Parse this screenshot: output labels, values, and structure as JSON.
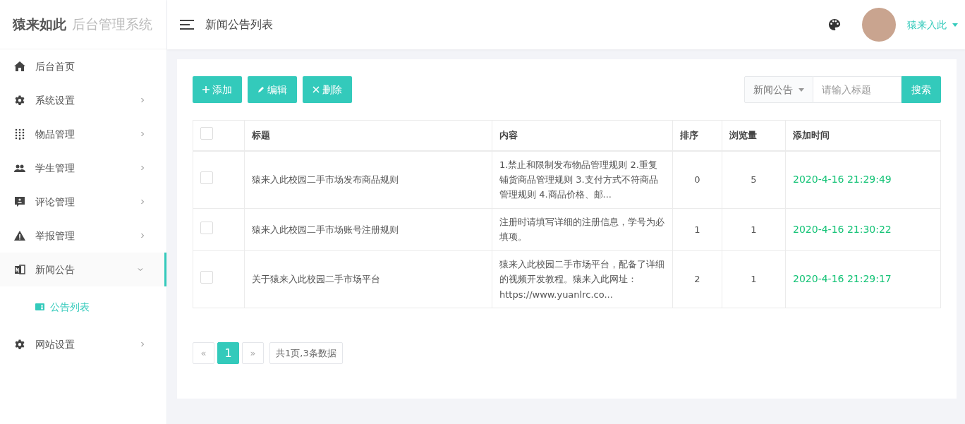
{
  "brand": {
    "logo": "猿来如此",
    "subtitle": "后台管理系统"
  },
  "header": {
    "title": "新闻公告列表",
    "user": "猿来入此"
  },
  "sidebar": {
    "items": [
      {
        "label": "后台首页",
        "selected": false
      },
      {
        "label": "系统设置",
        "has_children": true,
        "expanded": false,
        "selected": false
      },
      {
        "label": "物品管理",
        "has_children": true,
        "expanded": false,
        "selected": false
      },
      {
        "label": "学生管理",
        "has_children": true,
        "expanded": false,
        "selected": false
      },
      {
        "label": "评论管理",
        "has_children": true,
        "expanded": false,
        "selected": false
      },
      {
        "label": "举报管理",
        "has_children": true,
        "expanded": false,
        "selected": false
      },
      {
        "label": "新闻公告",
        "has_children": true,
        "expanded": true,
        "selected": true,
        "children": [
          {
            "label": "公告列表",
            "selected": true
          }
        ]
      },
      {
        "label": "网站设置",
        "has_children": true,
        "expanded": false,
        "selected": false
      }
    ]
  },
  "toolbar": {
    "buttons": [
      {
        "label": "添加",
        "kind": "add"
      },
      {
        "label": "编辑",
        "kind": "edit"
      },
      {
        "label": "删除",
        "kind": "delete"
      }
    ],
    "search": {
      "category": "新闻公告",
      "placeholder": "请输入标题",
      "button": "搜索"
    }
  },
  "table": {
    "columns": [
      "标题",
      "内容",
      "排序",
      "浏览量",
      "添加时间"
    ],
    "all_checked": false,
    "rows": [
      {
        "checked": false,
        "title": "猿来入此校园二手市场发布商品规则",
        "content": "1.禁止和限制发布物品管理规则 2.重复铺货商品管理规则 3.支付方式不符商品管理规则 4.商品价格、邮...",
        "sort": "0",
        "views": "5",
        "time": "2020-4-16 21:29:49"
      },
      {
        "checked": false,
        "title": "猿来入此校园二手市场账号注册规则",
        "content": "注册时请填写详细的注册信息，学号为必填项。",
        "sort": "1",
        "views": "1",
        "time": "2020-4-16 21:30:22"
      },
      {
        "checked": false,
        "title": "关于猿来入此校园二手市场平台",
        "content": "猿来入此校园二手市场平台，配备了详细的视频开发教程。猿来入此网址：https://www.yuanlrc.co...",
        "sort": "2",
        "views": "1",
        "time": "2020-4-16 21:29:17"
      }
    ]
  },
  "pagination": {
    "prev": "«",
    "pages": [
      {
        "label": "1",
        "selected": true
      }
    ],
    "next": "»",
    "summary": "共1页,3条数据"
  }
}
